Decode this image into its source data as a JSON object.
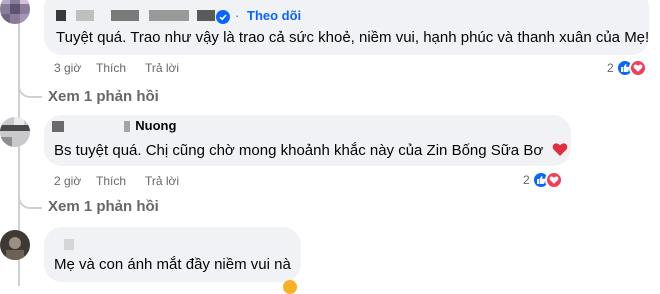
{
  "comments": [
    {
      "follow_label": "Theo dõi",
      "text": "Tuyệt quá. Trao như vậy là trao cả sức khoẻ, niềm vui, hạnh phúc và thanh xuân của Mẹ!",
      "time": "3 giờ",
      "like_label": "Thích",
      "reply_label": "Trả lời",
      "reaction_count": "2",
      "view_replies": "Xem 1 phản hồi"
    },
    {
      "author_visible": "Nuong",
      "text": "Bs tuyệt quá. Chị cũng chờ mong khoảnh khắc này của Zin Bống Sữa Bơ",
      "time": "2 giờ",
      "like_label": "Thích",
      "reply_label": "Trả lời",
      "reaction_count": "2",
      "view_replies": "Xem 1 phản hồi"
    },
    {
      "text": "Mẹ và con ánh mắt đầy niềm vui nà"
    }
  ],
  "colors": {
    "bubble": "#f0f2f5",
    "link_blue": "#0866ff",
    "meta_gray": "#65676b",
    "heart_red": "#f33e58"
  },
  "icons": [
    "like-icon",
    "heart-icon",
    "verified-icon"
  ]
}
